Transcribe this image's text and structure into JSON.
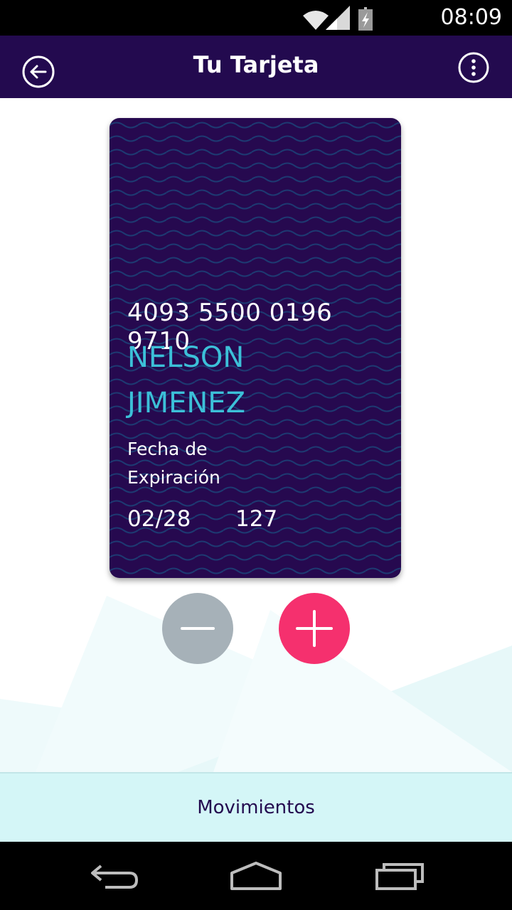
{
  "status_bar": {
    "time": "08:09",
    "icons": [
      "wifi-icon",
      "signal-icon",
      "battery-icon"
    ]
  },
  "app_bar": {
    "title": "Tu Tarjeta",
    "back_icon": "arrow-left-circle-icon",
    "menu_icon": "more-vertical-circle-icon"
  },
  "card": {
    "number": "4093 5500 0196 9710",
    "holder_first": "NELSON",
    "holder_last": "JIMENEZ",
    "expiry_label_line1": "Fecha de",
    "expiry_label_line2": "Expiración",
    "expiry": "02/28",
    "cvv": "127"
  },
  "actions": {
    "minus_icon": "minus-icon",
    "plus_icon": "plus-icon"
  },
  "bottom_tab": {
    "label": "Movimientos"
  },
  "colors": {
    "primary": "#230a4f",
    "card_name": "#3cc0d8",
    "plus": "#f5306e",
    "minus": "#a6b1b8",
    "bottom_tab": "#d4f6f7"
  }
}
